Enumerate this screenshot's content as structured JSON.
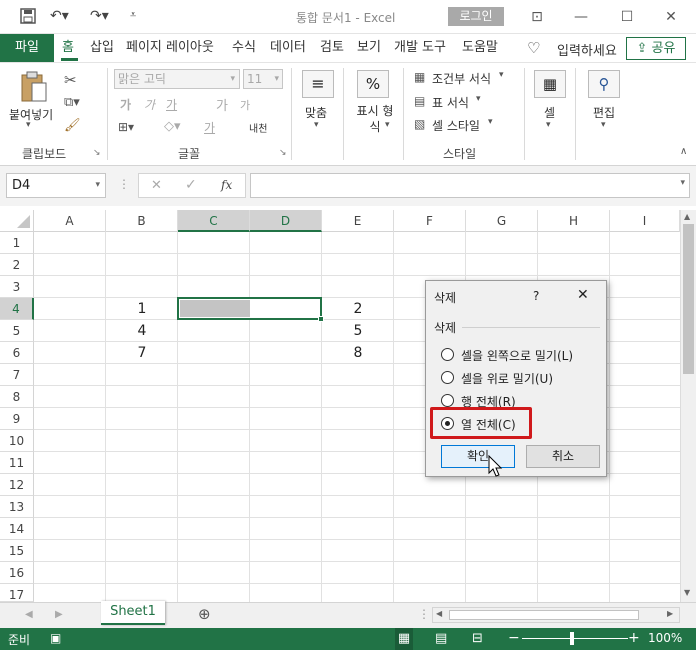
{
  "app": {
    "title": "통합 문서1  -  Excel",
    "login_label": "로그인",
    "share_label": "공유",
    "tell_me": "입력하세요"
  },
  "tabs": [
    "파일",
    "홈",
    "삽입",
    "페이지 레이아웃",
    "수식",
    "데이터",
    "검토",
    "보기",
    "개발 도구",
    "도움말"
  ],
  "ribbon": {
    "clipboard": {
      "paste": "붙여넣기",
      "group": "클립보드"
    },
    "font": {
      "name": "맑은 고딕",
      "size": "11",
      "group": "글꼴",
      "bold": "가",
      "italic": "가",
      "underline": "가",
      "grow": "가",
      "shrink": "가",
      "fontcolor": "가",
      "phonetic": "내천"
    },
    "align": {
      "label": "맞춤"
    },
    "number": {
      "label": "표시 형식",
      "symbol": "%"
    },
    "styles": {
      "conditional": "조건부 서식",
      "table": "표 서식",
      "cell": "셀 스타일",
      "group": "스타일"
    },
    "cells": {
      "label": "셀"
    },
    "edit": {
      "label": "편집"
    }
  },
  "formula_bar": {
    "name_box": "D4",
    "fx": "fx",
    "cancel": "✕",
    "enter": "✓"
  },
  "grid": {
    "columns": [
      "A",
      "B",
      "C",
      "D",
      "E",
      "F",
      "G",
      "H",
      "I"
    ],
    "rows": [
      "1",
      "2",
      "3",
      "4",
      "5",
      "6",
      "7",
      "8",
      "9",
      "10",
      "11",
      "12",
      "13",
      "14",
      "15",
      "16",
      "17"
    ],
    "cells": {
      "B4": "1",
      "B5": "4",
      "B6": "7",
      "E4": "2",
      "E5": "5",
      "E6": "8"
    }
  },
  "sheet_tabs": {
    "active": "Sheet1"
  },
  "status": {
    "ready": "준비",
    "zoom": "100%"
  },
  "dialog": {
    "title": "삭제",
    "help": "?",
    "section": "삭제",
    "options": [
      {
        "label": "셀을 왼쪽으로 밀기(L)",
        "selected": false
      },
      {
        "label": "셀을 위로 밀기(U)",
        "selected": false
      },
      {
        "label": "행 전체(R)",
        "selected": false
      },
      {
        "label": "열 전체(C)",
        "selected": true
      }
    ],
    "ok": "확인",
    "cancel": "취소",
    "highlight_color": "#d0191b"
  }
}
